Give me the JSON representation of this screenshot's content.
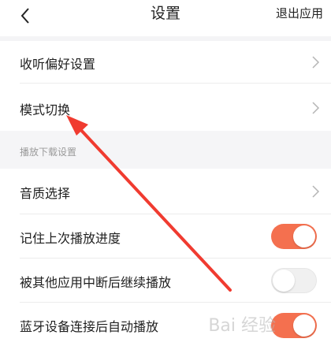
{
  "header": {
    "title": "设置",
    "action_label": "退出应用",
    "back_icon": "chevron-left-icon"
  },
  "rows_top": [
    {
      "label": "收听偏好设置",
      "control": "chevron"
    },
    {
      "label": "模式切换",
      "control": "chevron"
    }
  ],
  "section": {
    "label": "播放下载设置"
  },
  "rows_bottom": [
    {
      "label": "音质选择",
      "control": "chevron"
    },
    {
      "label": "记住上次播放进度",
      "control": "toggle",
      "checked": true
    },
    {
      "label": "被其他应用中断后继续播放",
      "control": "toggle",
      "checked": false
    },
    {
      "label": "蓝牙设备连接后自动播放",
      "control": "toggle",
      "checked": true
    }
  ],
  "watermark": {
    "text": "Bai 经验"
  },
  "colors": {
    "toggle_on": "#f4704f",
    "toggle_off": "#f0f0f0",
    "annotation": "#f03b30",
    "section_bg": "#f5f5f7"
  }
}
